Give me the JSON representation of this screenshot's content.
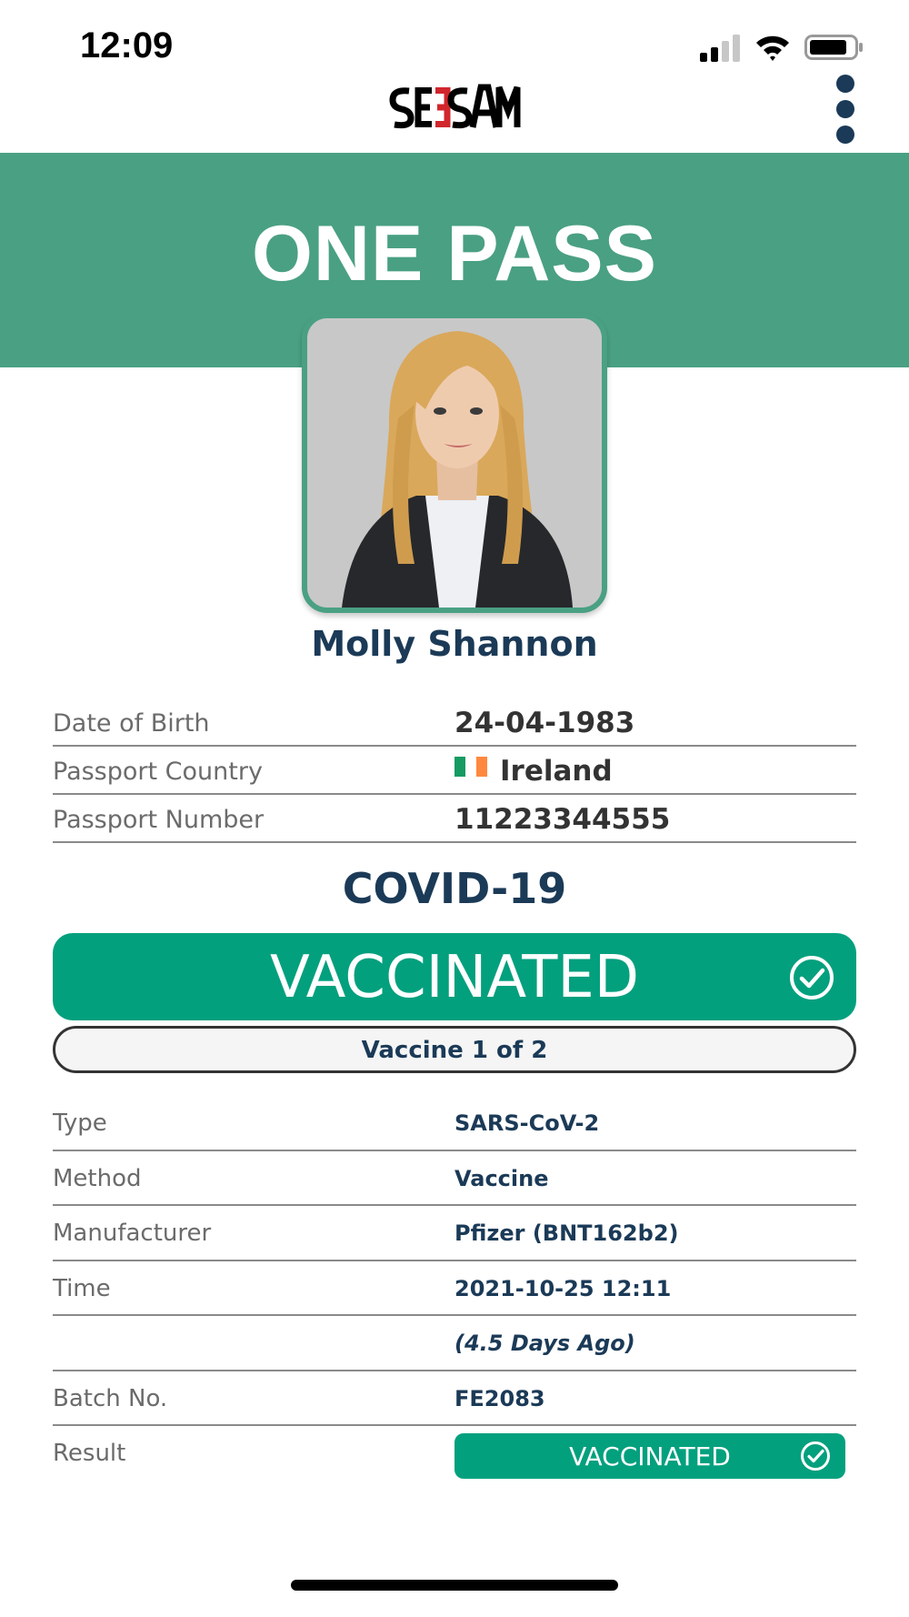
{
  "status_bar": {
    "time": "12:09"
  },
  "header": {
    "logo_text": "SEESAM",
    "menu_icon": "more-vertical-icon"
  },
  "hero": {
    "title": "ONE PASS"
  },
  "profile": {
    "name": "Molly Shannon"
  },
  "personal_info": [
    {
      "label": "Date of Birth",
      "value": "24-04-1983"
    },
    {
      "label": "Passport Country",
      "value": "Ireland",
      "icon": "ireland-flag-icon"
    },
    {
      "label": "Passport Number",
      "value": "11223344555"
    }
  ],
  "covid": {
    "title": "COVID-19",
    "status": "VACCINATED",
    "dose": "Vaccine 1 of 2"
  },
  "details": [
    {
      "label": "Type",
      "value": "SARS-CoV-2"
    },
    {
      "label": "Method",
      "value": "Vaccine"
    },
    {
      "label": "Manufacturer",
      "value": "Pfizer (BNT162b2)"
    },
    {
      "label": "Time",
      "value": "2021-10-25 12:11"
    },
    {
      "label": "",
      "value": "(4.5 Days Ago)"
    },
    {
      "label": "Batch No.",
      "value": "FE2083"
    },
    {
      "label": "Result",
      "value": "VACCINATED"
    }
  ],
  "colors": {
    "brand_green": "#4aa083",
    "status_green": "#03a07e",
    "navy": "#1b3a57",
    "logo_red": "#d0262c"
  }
}
